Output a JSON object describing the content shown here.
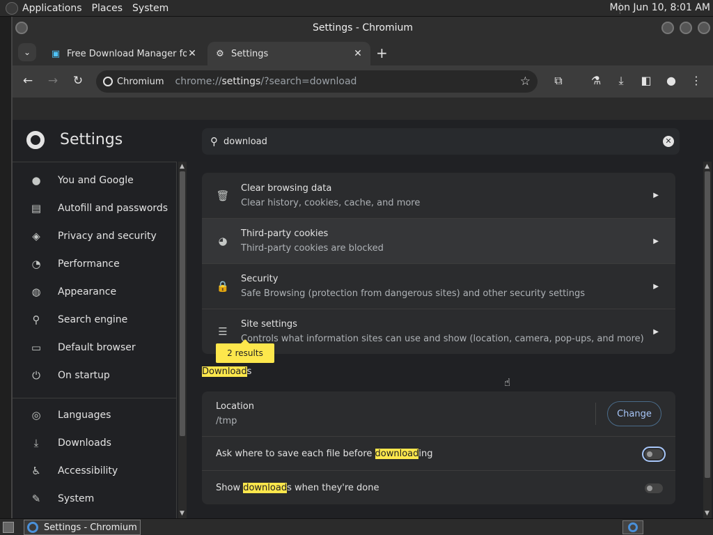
{
  "os": {
    "menus": [
      "Applications",
      "Places",
      "System"
    ],
    "clock": "Mon Jun 10, 8:01 AM"
  },
  "window": {
    "title": "Settings - Chromium"
  },
  "tabs": [
    {
      "title": "Free Download Manager for L",
      "icon": "fdm-icon",
      "active": false
    },
    {
      "title": "Settings",
      "icon": "gear-icon",
      "active": true
    }
  ],
  "toolbar": {
    "site_chip": "Chromium",
    "url_prefix": "chrome://",
    "url_host": "settings",
    "url_rest": "/?search=download"
  },
  "settings": {
    "title": "Settings",
    "search_value": "download"
  },
  "sidebar": {
    "items": [
      {
        "label": "You and Google",
        "icon": "person-icon",
        "glyph": "●"
      },
      {
        "label": "Autofill and passwords",
        "icon": "clipboard-icon",
        "glyph": "▤"
      },
      {
        "label": "Privacy and security",
        "icon": "shield-icon",
        "glyph": "◈"
      },
      {
        "label": "Performance",
        "icon": "gauge-icon",
        "glyph": "◔"
      },
      {
        "label": "Appearance",
        "icon": "palette-icon",
        "glyph": "◍"
      },
      {
        "label": "Search engine",
        "icon": "search-icon",
        "glyph": "⚲"
      },
      {
        "label": "Default browser",
        "icon": "browser-icon",
        "glyph": "▭"
      },
      {
        "label": "On startup",
        "icon": "power-icon",
        "glyph": "⏻"
      },
      {
        "label": "Languages",
        "icon": "globe-icon",
        "glyph": "◎"
      },
      {
        "label": "Downloads",
        "icon": "download-icon",
        "glyph": "⤓"
      },
      {
        "label": "Accessibility",
        "icon": "accessibility-icon",
        "glyph": "♿"
      },
      {
        "label": "System",
        "icon": "wrench-icon",
        "glyph": "✎"
      }
    ]
  },
  "privacy_rows": [
    {
      "title": "Clear browsing data",
      "subtitle": "Clear history, cookies, cache, and more",
      "icon": "trash-icon",
      "glyph": "🗑"
    },
    {
      "title": "Third-party cookies",
      "subtitle": "Third-party cookies are blocked",
      "icon": "cookie-icon",
      "glyph": "◕"
    },
    {
      "title": "Security",
      "subtitle": "Safe Browsing (protection from dangerous sites) and other security settings",
      "icon": "lock-icon",
      "glyph": "🔒"
    },
    {
      "title": "Site settings",
      "subtitle": "Controls what information sites can use and show (location, camera, pop-ups, and more)",
      "icon": "sliders-icon",
      "glyph": "☰"
    }
  ],
  "results_bubble": "2 results",
  "downloads": {
    "section_highlight": "Download",
    "section_rest": "s",
    "location_label": "Location",
    "location_value": "/tmp",
    "change_label": "Change",
    "ask_prefix": "Ask where to save each file before ",
    "ask_highlight": "download",
    "ask_suffix": "ing",
    "ask_enabled": false,
    "show_prefix": "Show ",
    "show_highlight": "download",
    "show_suffix": "s when they're done",
    "show_enabled": false
  },
  "taskbar": {
    "task_label": "Settings - Chromium"
  }
}
